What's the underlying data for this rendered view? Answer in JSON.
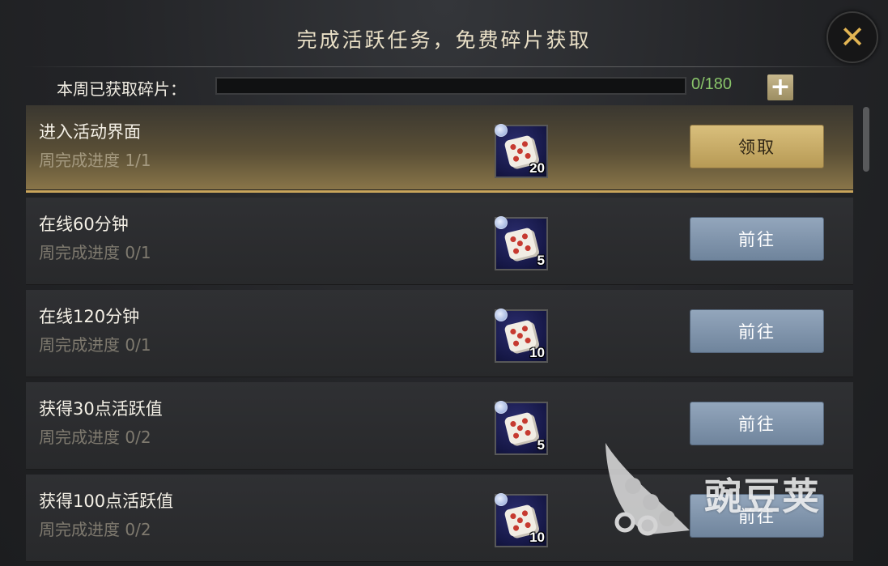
{
  "header": {
    "title": "完成活跃任务，免费碎片获取",
    "close_glyph": "✕"
  },
  "weekly": {
    "label": "本周已获取碎片：",
    "count_text": "0/180",
    "fraction": 0,
    "plus_glyph": "+"
  },
  "tasks": [
    {
      "name": "进入活动界面",
      "progress": "周完成进度 1/1",
      "reward": "20",
      "button": "领取",
      "state": "claim"
    },
    {
      "name": "在线60分钟",
      "progress": "周完成进度 0/1",
      "reward": "5",
      "button": "前往",
      "state": "go"
    },
    {
      "name": "在线120分钟",
      "progress": "周完成进度 0/1",
      "reward": "10",
      "button": "前往",
      "state": "go"
    },
    {
      "name": "获得30点活跃值",
      "progress": "周完成进度 0/2",
      "reward": "5",
      "button": "前往",
      "state": "go"
    },
    {
      "name": "获得100点活跃值",
      "progress": "周完成进度 0/2",
      "reward": "10",
      "button": "前往",
      "state": "go"
    }
  ],
  "watermark": {
    "text": "豌豆荚"
  },
  "colors": {
    "accent_gold": "#c9a55b",
    "progress_green": "#89c46a",
    "go_button": "#7f93aa"
  },
  "icons": {
    "reward_item": "dice-fragment-icon",
    "close": "close-icon",
    "plus": "plus-icon"
  }
}
